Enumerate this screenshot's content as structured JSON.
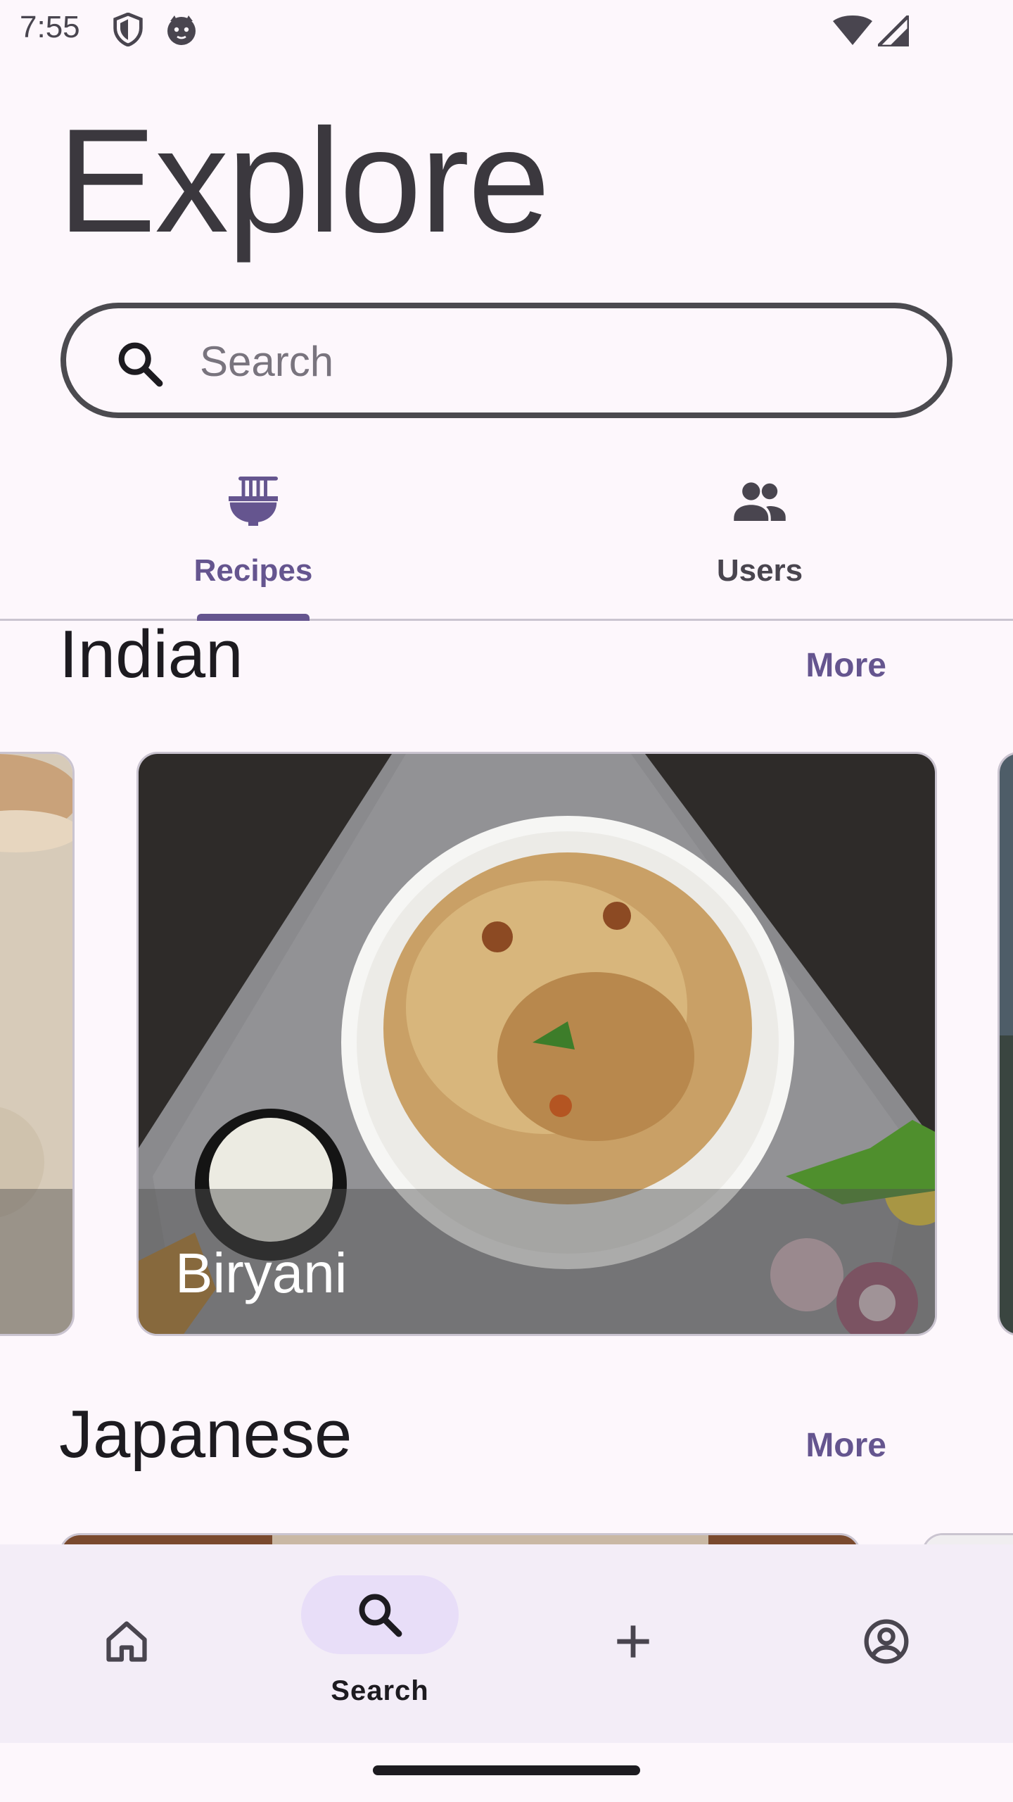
{
  "status_bar": {
    "time": "7:55",
    "icons": [
      "shield-icon",
      "cat-face-icon",
      "wifi-icon",
      "signal-icon"
    ]
  },
  "page": {
    "title": "Explore"
  },
  "search": {
    "placeholder": "Search",
    "value": ""
  },
  "tabs": [
    {
      "label": "Recipes",
      "icon": "noodle-bowl-icon",
      "selected": true
    },
    {
      "label": "Users",
      "icon": "people-icon",
      "selected": false
    }
  ],
  "sections": [
    {
      "title": "Indian",
      "more_label": "More",
      "cards": [
        {
          "label": "Biryani"
        }
      ]
    },
    {
      "title": "Japanese",
      "more_label": "More"
    }
  ],
  "bottom_nav": [
    {
      "icon": "home-icon",
      "label": "",
      "selected": false
    },
    {
      "icon": "search-icon",
      "label": "Search",
      "selected": true
    },
    {
      "icon": "plus-icon",
      "label": "",
      "selected": false
    },
    {
      "icon": "account-circle-icon",
      "label": "",
      "selected": false
    }
  ],
  "colors": {
    "background": "#fdf7fc",
    "accent": "#65558f",
    "nav_pill": "#e8def8",
    "nav_background": "#f3edf7"
  }
}
